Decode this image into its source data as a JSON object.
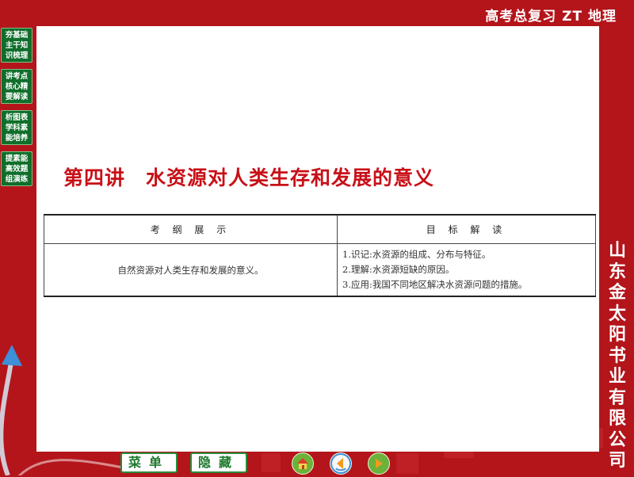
{
  "header": {
    "title": "高考总复习 ZT 地理"
  },
  "left_nav": [
    {
      "lines": [
        "夯基础",
        "主干知",
        "识梳理"
      ]
    },
    {
      "lines": [
        "讲考点",
        "核心精",
        "要解读"
      ]
    },
    {
      "lines": [
        "析图表",
        "学科素",
        "能培养"
      ]
    },
    {
      "lines": [
        "提素能",
        "高效题",
        "组演练"
      ]
    }
  ],
  "lesson": {
    "title": "第四讲　水资源对人类生存和发展的意义"
  },
  "syllabus_table": {
    "headers": [
      "考 纲 展 示",
      "目 标 解 读"
    ],
    "left_cell": "自然资源对人类生存和发展的意义。",
    "goals": [
      "1.识记:水资源的组成、分布与特征。",
      "2.理解:水资源短缺的原因。",
      "3.应用:我国不同地区解决水资源问题的措施。"
    ]
  },
  "publisher": {
    "chars": [
      "山",
      "东",
      "金",
      "太",
      "阳",
      "书",
      "业",
      "有",
      "限",
      "公",
      "司"
    ]
  },
  "bottom_bar": {
    "menu_label": "菜单",
    "hide_label": "隐藏",
    "home_icon": "home-icon",
    "back_icon": "back-icon",
    "forward_icon": "forward-icon"
  },
  "colors": {
    "background": "#b3151b",
    "title_red": "#c81018",
    "nav_green": "#0f6e2a"
  }
}
